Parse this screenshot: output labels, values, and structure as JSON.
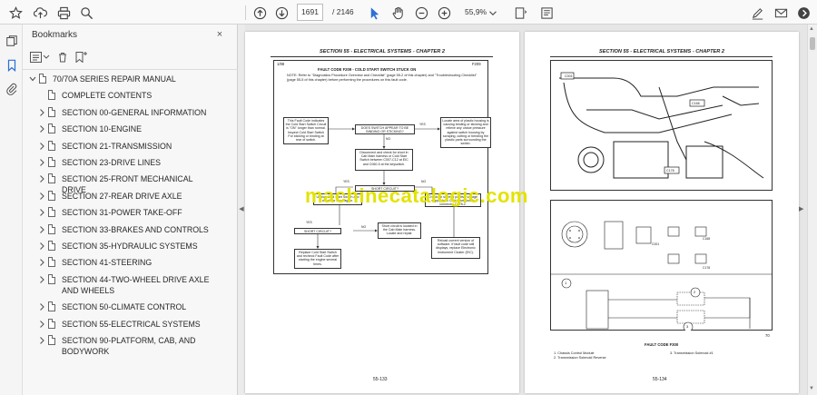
{
  "toolbar": {
    "current_page": "1691",
    "total_pages": "/ 2146",
    "zoom": "55,9%",
    "icons": [
      "star-icon",
      "upload-icon",
      "print-icon",
      "zoom-magnifier-icon",
      "page-up-icon",
      "page-down-icon",
      "select-arrow-icon",
      "hand-icon",
      "zoom-out-icon",
      "zoom-in-icon",
      "zoom-dropdown-icon",
      "text-select-icon",
      "comment-icon",
      "sign-icon",
      "mail-icon",
      "account-icon"
    ]
  },
  "bookmarks": {
    "title": "Bookmarks",
    "close": "×",
    "items": [
      {
        "label": "70/70A SERIES REPAIR MANUAL",
        "level": 0,
        "expanded": true
      },
      {
        "label": "COMPLETE CONTENTS",
        "level": 1,
        "expanded": null
      },
      {
        "label": "SECTION 00-GENERAL INFORMATION",
        "level": 1,
        "expanded": false
      },
      {
        "label": "SECTION 10-ENGINE",
        "level": 1,
        "expanded": false
      },
      {
        "label": "SECTION 21-TRANSMISSION",
        "level": 1,
        "expanded": false
      },
      {
        "label": "SECTION 23-DRIVE LINES",
        "level": 1,
        "expanded": false
      },
      {
        "label": "SECTION 25-FRONT MECHANICAL DRIVE",
        "level": 1,
        "expanded": false
      },
      {
        "label": "SECTION 27-REAR DRIVE AXLE",
        "level": 1,
        "expanded": false
      },
      {
        "label": "SECTION 31-POWER TAKE-OFF",
        "level": 1,
        "expanded": false
      },
      {
        "label": "SECTION 33-BRAKES AND CONTROLS",
        "level": 1,
        "expanded": false
      },
      {
        "label": "SECTION 35-HYDRAULIC SYSTEMS",
        "level": 1,
        "expanded": false
      },
      {
        "label": "SECTION 41-STEERING",
        "level": 1,
        "expanded": false
      },
      {
        "label": "SECTION 44-TWO-WHEEL DRIVE AXLE AND WHEELS",
        "level": 1,
        "expanded": false
      },
      {
        "label": "SECTION 50-CLIMATE CONTROL",
        "level": 1,
        "expanded": false
      },
      {
        "label": "SECTION 55-ELECTRICAL SYSTEMS",
        "level": 1,
        "expanded": false
      },
      {
        "label": "SECTION 90-PLATFORM, CAB, AND BODYWORK",
        "level": 1,
        "expanded": false
      }
    ]
  },
  "page_left": {
    "header": "SECTION 55 - ELECTRICAL SYSTEMS - CHAPTER 2",
    "fault_ref": "1/88",
    "fault_code": "F209",
    "fault_title": "FAULT CODE F209 - COLD START SWITCH STUCK ON",
    "note": "NOTE: Refer to \"Diagnostics Procedure Overview and Checklist\" (page 55-2 of this chapter) and \"Troubleshooting Checklist\" (page 55-5 of this chapter) before performing the procedures on this fault code.",
    "flow": {
      "start": "This Fault Code indicates the Cold Start Switch Circuit is \"ON\" longer than normal. Inspect Cold Start Switch For sticking or binding at rear of switch.",
      "q1": "DOES SWITCH APPEAR TO BE BINDING OR STICKING?",
      "yes1": "YES",
      "no1": "NO",
      "fix1": "Locate area of plastic housing is causing binding or sticking and relieve any undue pressure against switch housing by scraping, cutting or bending the plastic parts surrounding the switch.",
      "disconnect": "Disconnect and check for short in Cab Main harness or Cold Start Switch between C007-C12 at EIC and C060-5 at the keyswitch.",
      "q2": "SHORT CIRCUIT?",
      "yes2": "YES",
      "no2": "NO",
      "unplug": "Unplug Cold Start Switch and check for short again.",
      "check_pos": "Check for short to positive voltage supply from Cold Start Switch connector C078-2.",
      "q3": "SHORT CIRCUIT?",
      "yes3": "YES",
      "no3": "NO",
      "short_located": "Short circuit is located in the Cab Main harness. Locate and repair.",
      "replace": "Replace Cold Start Switch and recheck Fault Code after starting the engine several times.",
      "reload": "Reload current version of software. If fault code still displays, replace Electronic Instrument Cluster (EIC)."
    },
    "page_number": "55-133"
  },
  "page_right": {
    "header": "SECTION 55 - ELECTRICAL SYSTEMS - CHAPTER 2",
    "connectors": [
      "C001",
      "C168",
      "C178"
    ],
    "callouts": [
      "1",
      "2",
      "3"
    ],
    "figure_number": "70",
    "figure_title": "FAULT CODE F300",
    "legend": [
      "1.   Chassis Control Module",
      "2.   Transmission Solenoid Reverse",
      "3.   Transmission Solenoid #1"
    ],
    "page_number": "55-134"
  },
  "watermark": "machinecatalogic.com"
}
